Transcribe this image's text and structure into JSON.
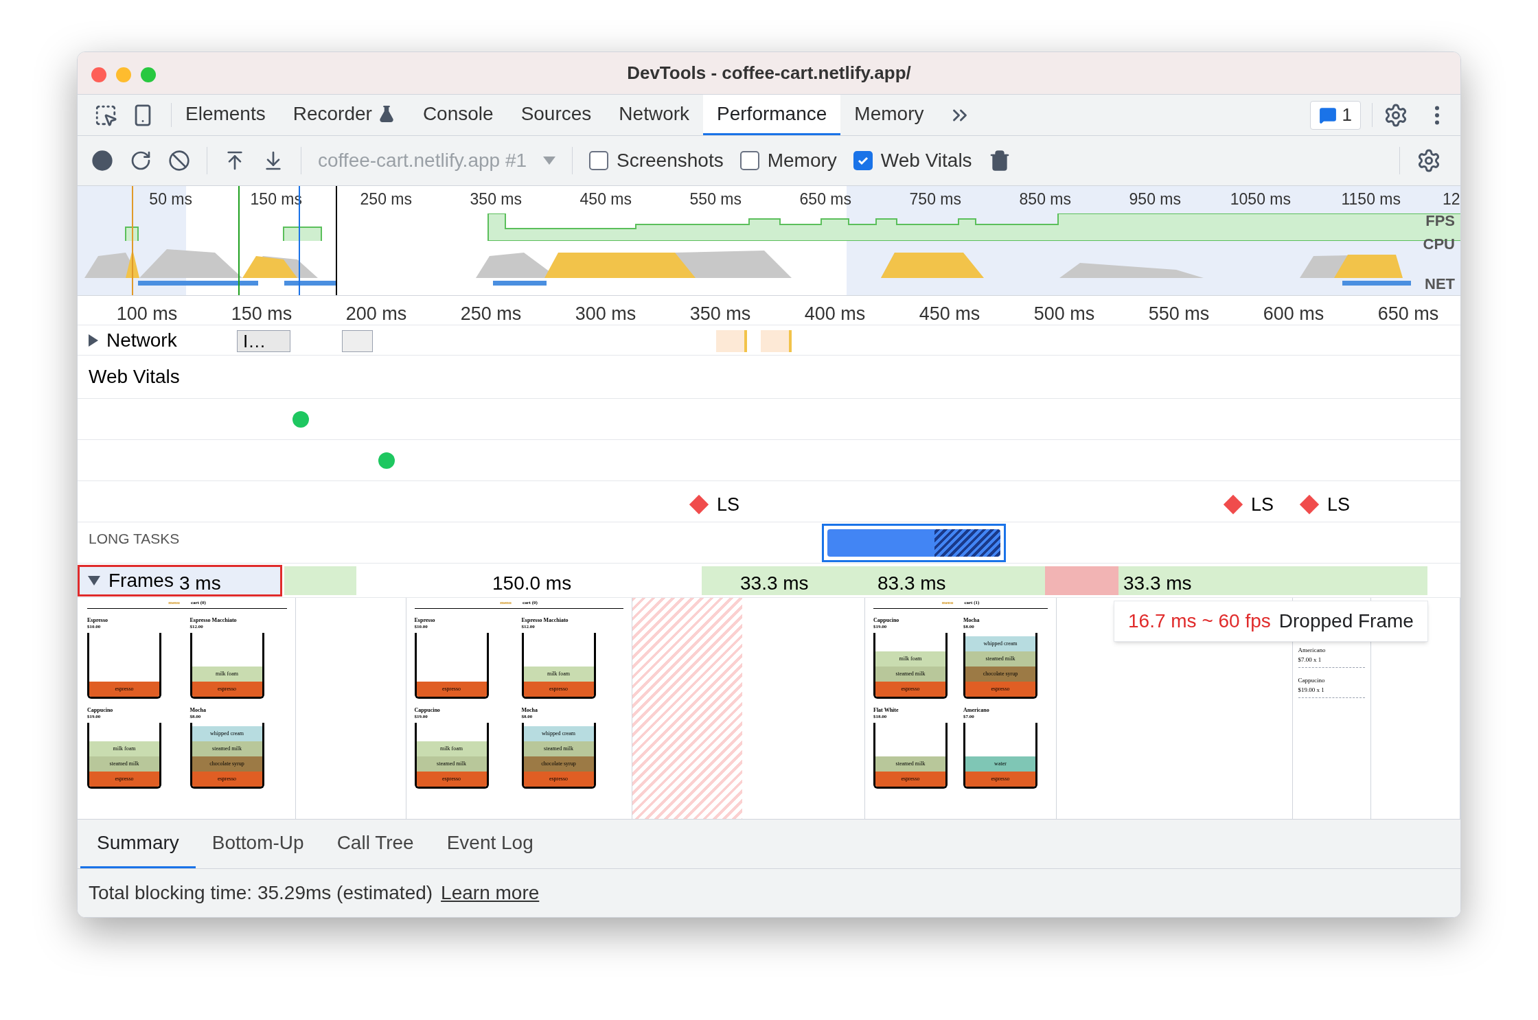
{
  "window": {
    "title": "DevTools - coffee-cart.netlify.app/"
  },
  "tabs": [
    {
      "label": "Elements",
      "selected": false,
      "flask": false
    },
    {
      "label": "Recorder",
      "selected": false,
      "flask": true
    },
    {
      "label": "Console",
      "selected": false,
      "flask": false
    },
    {
      "label": "Sources",
      "selected": false,
      "flask": false
    },
    {
      "label": "Network",
      "selected": false,
      "flask": false
    },
    {
      "label": "Performance",
      "selected": true,
      "flask": false
    },
    {
      "label": "Memory",
      "selected": false,
      "flask": false
    }
  ],
  "issues_count": "1",
  "toolbar": {
    "target": "coffee-cart.netlify.app #1",
    "options": [
      {
        "label": "Screenshots",
        "checked": false
      },
      {
        "label": "Memory",
        "checked": false
      },
      {
        "label": "Web Vitals",
        "checked": true
      }
    ]
  },
  "overview": {
    "ticks": [
      "50 ms",
      "150 ms",
      "250 ms",
      "350 ms",
      "450 ms",
      "550 ms",
      "650 ms",
      "750 ms",
      "850 ms",
      "950 ms",
      "1050 ms",
      "1150 ms",
      "12"
    ],
    "lanes": [
      "FPS",
      "CPU",
      "NET"
    ]
  },
  "ruler": [
    "100 ms",
    "150 ms",
    "200 ms",
    "250 ms",
    "300 ms",
    "350 ms",
    "400 ms",
    "450 ms",
    "500 ms",
    "550 ms",
    "600 ms",
    "650 ms"
  ],
  "network": {
    "label": "Network",
    "expanded": false,
    "request": "I…"
  },
  "web_vitals": {
    "title": "Web Vitals",
    "layout_shifts": [
      {
        "label": "LS"
      },
      {
        "label": "LS"
      },
      {
        "label": "LS"
      }
    ]
  },
  "long_tasks": {
    "title": "LONG TASKS",
    "selected": true
  },
  "frames": {
    "label": "Frames",
    "expanded": true,
    "durations": [
      "3 ms",
      "150.0 ms",
      "33.3 ms",
      "83.3 ms",
      "33.3 ms"
    ]
  },
  "tooltip": {
    "timing": "16.7 ms ~ 60 fps",
    "label": "Dropped Frame"
  },
  "thumbnails": [
    {
      "kind": "menu",
      "nav": "menu",
      "cart": "cart (0)",
      "drinks": [
        {
          "name": "Espresso",
          "price": "$10.00",
          "layers": [
            {
              "kind": "espresso",
              "label": "espresso"
            }
          ]
        },
        {
          "name": "Espresso Macchiato",
          "price": "$12.00",
          "layers": [
            {
              "kind": "milk_foam",
              "label": "milk foam"
            },
            {
              "kind": "espresso",
              "label": "espresso"
            }
          ]
        },
        {
          "name": "Cappucino",
          "price": "$19.00",
          "layers": [
            {
              "kind": "milk_foam",
              "label": "milk foam"
            },
            {
              "kind": "steamed_milk",
              "label": "steamed milk"
            },
            {
              "kind": "espresso",
              "label": "espresso"
            }
          ]
        },
        {
          "name": "Mocha",
          "price": "$8.00",
          "layers": [
            {
              "kind": "whipped_cream",
              "label": "whipped cream"
            },
            {
              "kind": "steamed_milk",
              "label": "steamed milk"
            },
            {
              "kind": "chocolate_syrup",
              "label": "chocolate syrup"
            },
            {
              "kind": "espresso",
              "label": "espresso"
            }
          ]
        }
      ]
    },
    {
      "kind": "blank"
    },
    {
      "kind": "menu",
      "nav": "menu",
      "cart": "cart (0)",
      "drinks": [
        {
          "name": "Espresso",
          "price": "$10.00",
          "layers": [
            {
              "kind": "espresso",
              "label": "espresso"
            }
          ]
        },
        {
          "name": "Espresso Macchiato",
          "price": "$12.00",
          "layers": [
            {
              "kind": "milk_foam",
              "label": "milk foam"
            },
            {
              "kind": "espresso",
              "label": "espresso"
            }
          ]
        },
        {
          "name": "Cappucino",
          "price": "$19.00",
          "layers": [
            {
              "kind": "milk_foam",
              "label": "milk foam"
            },
            {
              "kind": "steamed_milk",
              "label": "steamed milk"
            },
            {
              "kind": "espresso",
              "label": "espresso"
            }
          ]
        },
        {
          "name": "Mocha",
          "price": "$8.00",
          "layers": [
            {
              "kind": "whipped_cream",
              "label": "whipped cream"
            },
            {
              "kind": "steamed_milk",
              "label": "steamed milk"
            },
            {
              "kind": "chocolate_syrup",
              "label": "chocolate syrup"
            },
            {
              "kind": "espresso",
              "label": "espresso"
            }
          ]
        }
      ]
    },
    {
      "kind": "dropped"
    },
    {
      "kind": "blank"
    },
    {
      "kind": "menu",
      "nav": "menu",
      "cart": "cart (1)",
      "drinks": [
        {
          "name": "Cappucino",
          "price": "$19.00",
          "layers": [
            {
              "kind": "milk_foam",
              "label": "milk foam"
            },
            {
              "kind": "steamed_milk",
              "label": "steamed milk"
            },
            {
              "kind": "espresso",
              "label": "espresso"
            }
          ]
        },
        {
          "name": "Mocha",
          "price": "$8.00",
          "layers": [
            {
              "kind": "whipped_cream",
              "label": "whipped cream"
            },
            {
              "kind": "steamed_milk",
              "label": "steamed milk"
            },
            {
              "kind": "chocolate_syrup",
              "label": "chocolate syrup"
            },
            {
              "kind": "espresso",
              "label": "espresso"
            }
          ]
        },
        {
          "name": "Flat White",
          "price": "$18.00",
          "layers": [
            {
              "kind": "steamed_milk",
              "label": "steamed milk"
            },
            {
              "kind": "espresso",
              "label": "espresso"
            }
          ]
        },
        {
          "name": "Americano",
          "price": "$7.00",
          "layers": [
            {
              "kind": "water",
              "label": "water"
            },
            {
              "kind": "espresso",
              "label": "espresso"
            }
          ]
        }
      ]
    },
    {
      "kind": "blank"
    },
    {
      "kind": "cart",
      "items": [
        {
          "name": "Americano",
          "amount": "$7.00 x 1"
        },
        {
          "name": "Cappucino",
          "amount": "$19.00 x 1"
        }
      ]
    },
    {
      "kind": "blank"
    }
  ],
  "bottom_tabs": [
    {
      "label": "Summary",
      "selected": true
    },
    {
      "label": "Bottom-Up",
      "selected": false
    },
    {
      "label": "Call Tree",
      "selected": false
    },
    {
      "label": "Event Log",
      "selected": false
    }
  ],
  "summary": {
    "text": "Total blocking time: 35.29ms (estimated)",
    "link": "Learn more"
  }
}
